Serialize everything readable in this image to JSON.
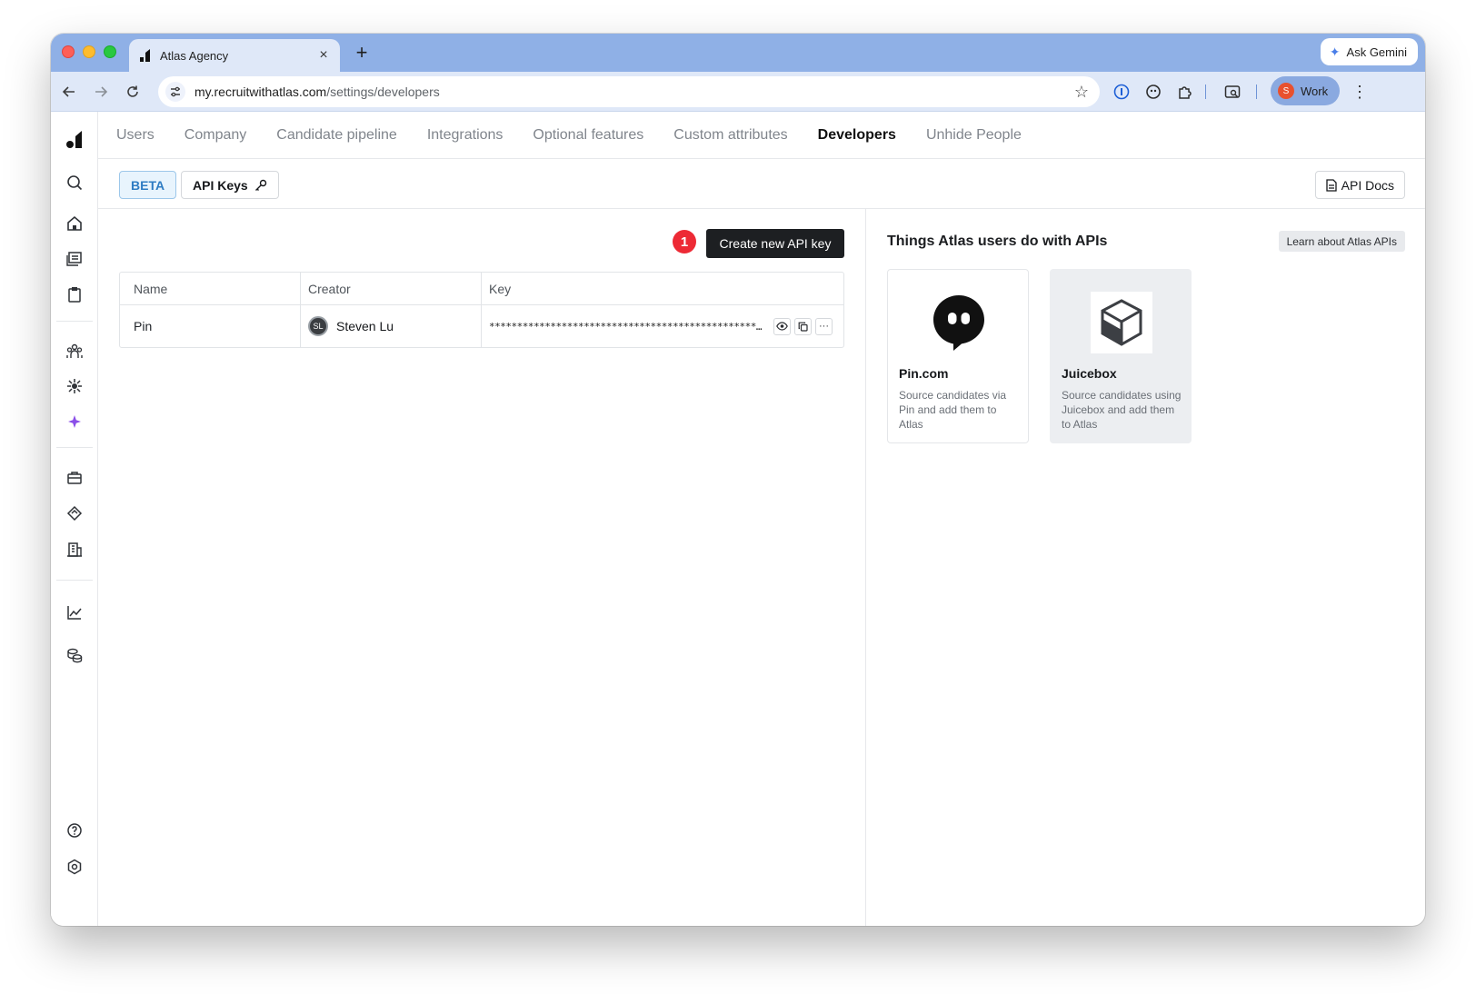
{
  "browser": {
    "tab_title": "Atlas Agency",
    "tab_close": "×",
    "new_tab": "+",
    "ask_gemini": "Ask Gemini",
    "url_host": "my.recruitwithatlas.com",
    "url_path": "/settings/developers",
    "profile_initial": "S",
    "profile_label": "Work",
    "menu": "⋮",
    "accent": "#8fb0e6"
  },
  "topnav": {
    "items": [
      "Users",
      "Company",
      "Candidate pipeline",
      "Integrations",
      "Optional features",
      "Custom attributes",
      "Developers",
      "Unhide People"
    ],
    "active": "Developers"
  },
  "subbar": {
    "beta_label": "BETA",
    "api_keys_label": "API Keys",
    "api_docs_label": "API Docs"
  },
  "keys": {
    "step_number": "1",
    "create_label": "Create new API key",
    "columns": [
      "Name",
      "Creator",
      "Key"
    ],
    "rows": [
      {
        "name": "Pin",
        "creator_initials": "SL",
        "creator": "Steven Lu",
        "key_masked": "*****************************************************..."
      }
    ],
    "action_more": "···"
  },
  "integrations": {
    "title": "Things Atlas users do with APIs",
    "learn_label": "Learn about Atlas APIs",
    "cards": [
      {
        "name": "Pin.com",
        "description": "Source candidates via Pin and add them to Atlas",
        "icon": "pin-logo-icon"
      },
      {
        "name": "Juicebox",
        "description": "Source candidates using Juicebox and add them to Atlas",
        "icon": "juicebox-logo-icon"
      }
    ]
  },
  "colors": {
    "primary_button": "#1d1f22",
    "step_badge": "#ed2a35",
    "beta_text": "#2e7cc3"
  }
}
